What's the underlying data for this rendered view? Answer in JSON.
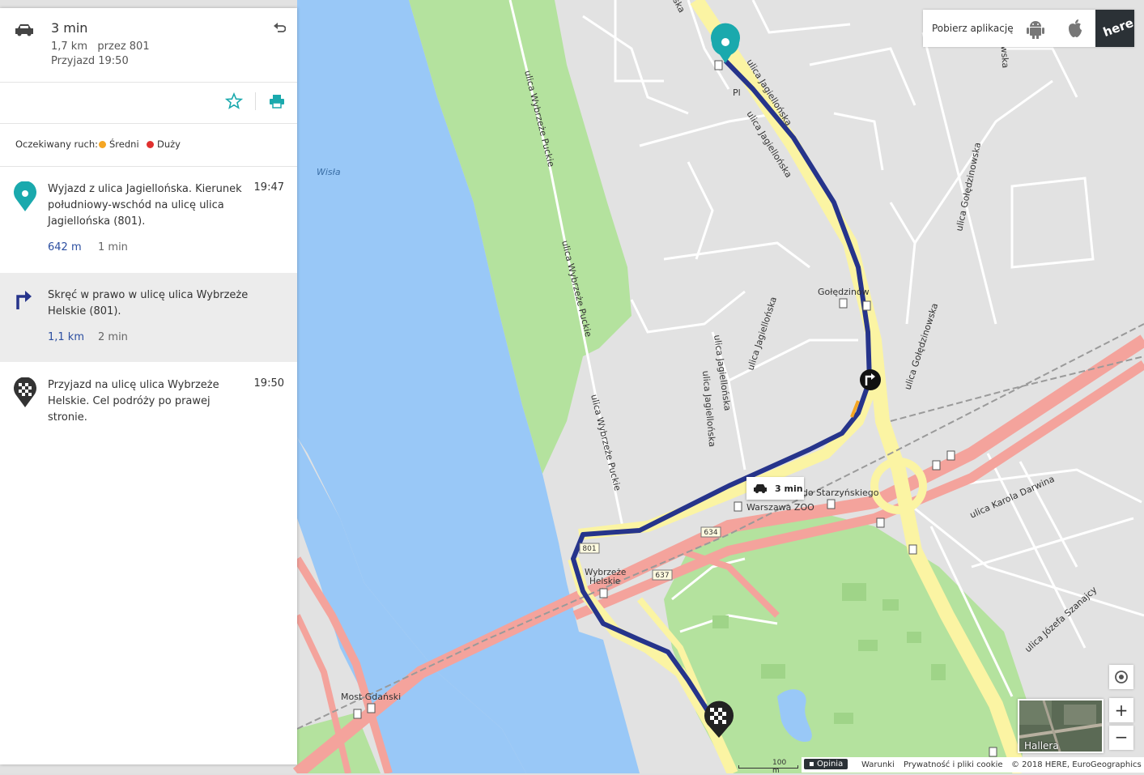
{
  "summary": {
    "duration": "3 min",
    "distance": "1,7 km",
    "via": "przez 801",
    "arrival": "Przyjazd 19:50"
  },
  "traffic": {
    "label": "Oczekiwany ruch:",
    "medium": "Średni",
    "heavy": "Duży",
    "medium_color": "#f5a623",
    "heavy_color": "#e0312f"
  },
  "maneuvers": [
    {
      "icon": "start-pin-icon",
      "text": "Wyjazd z ulica Jagiellońska. Kierunek południowy-wschód na ulicę ulica Jagiellońska (801).",
      "time": "19:47",
      "distance": "642 m",
      "duration": "1 min"
    },
    {
      "icon": "turn-right-icon",
      "text": "Skręć w prawo w ulicę ulica Wybrzeże Helskie (801).",
      "time": "",
      "distance": "1,1 km",
      "duration": "2 min"
    },
    {
      "icon": "finish-flag-icon",
      "text": "Przyjazd na ulicę ulica Wybrzeże Helskie. Cel podróży po prawej stronie.",
      "time": "19:50",
      "distance": "",
      "duration": ""
    }
  ],
  "topbar": {
    "app_text": "Pobierz aplikację",
    "logo": "here"
  },
  "map_labels": {
    "river": "Wisła",
    "wybrzeze_puckie": "ulica Wybrzeże Puckie",
    "jagiellonska": "ulica Jagiellońska",
    "goledzinowska": "ulica Gołędzinowska",
    "goledzinow": "Gołędzinów",
    "rondo": "Rondo Starzyńskiego",
    "zoo": "Warszawa ZOO",
    "wybrzeze_helskie": "Wybrzeże Helskie",
    "most": "Most Gdański",
    "darwina": "ulica Karola Darwina",
    "szanajcy": "ulica Józefa Szanajcy",
    "road_801": "801",
    "road_634": "634",
    "road_637": "637",
    "pl": "Pl",
    "ska": "ska",
    "owska": "owska"
  },
  "route_bubble": "3 min",
  "minimap_label": "Hallera",
  "scale_label": "100 m",
  "zoom": {
    "in": "+",
    "out": "−"
  },
  "footer": {
    "feedback": "Opinia",
    "terms": "Warunki",
    "privacy": "Prywatność i pliki cookie",
    "copyright": "© 2018 HERE, EuroGeographics"
  },
  "colors": {
    "route": "#26348b",
    "water": "#99c8f7",
    "park": "#b4e29e",
    "land": "#e2e2e2",
    "highway": "#f4a39c",
    "main_road": "#fbf4a3",
    "accent": "#1aa9ad"
  }
}
